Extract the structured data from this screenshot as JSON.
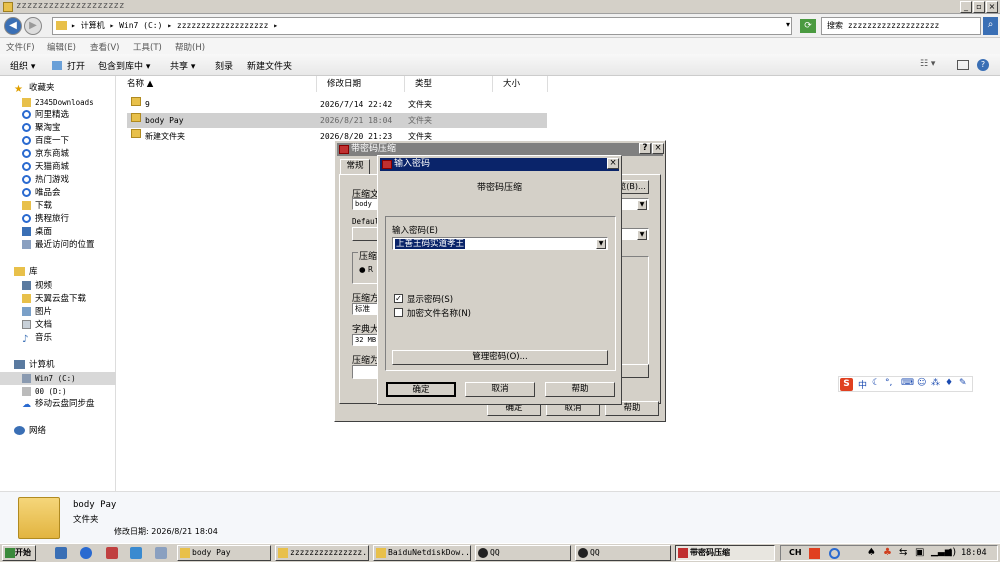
{
  "window": {
    "title": "zzzzzzzzzzzzzzzzzzzz"
  },
  "address": {
    "path": "▸ 计算机 ▸ Win7 (C:) ▸ zzzzzzzzzzzzzzzzzzz ▸",
    "search_placeholder": "搜索 zzzzzzzzzzzzzzzzzzz"
  },
  "menu": [
    "文件(F)",
    "编辑(E)",
    "查看(V)",
    "工具(T)",
    "帮助(H)"
  ],
  "toolbar": {
    "organize": "组织 ▾",
    "open": "打开",
    "include": "包含到库中 ▾",
    "share": "共享 ▾",
    "burn": "刻录",
    "new_folder": "新建文件夹"
  },
  "sidebar": {
    "favorites": "收藏夹",
    "fav_items": [
      "2345Downloads",
      "阿里精选",
      "聚淘宝",
      "百度一下",
      "京东商城",
      "天猫商城",
      "热门游戏",
      "唯品会",
      "下载",
      "携程旅行",
      "桌面",
      "最近访问的位置"
    ],
    "libraries": "库",
    "lib_items": [
      "视频",
      "天翼云盘下载",
      "图片",
      "文档",
      "音乐"
    ],
    "computer": "计算机",
    "comp_items": [
      "Win7 (C:)",
      "00 (D:)",
      "移动云盘同步盘"
    ],
    "network": "网络"
  },
  "columns": {
    "name": "名称 ▲",
    "date": "修改日期",
    "type": "类型",
    "size": "大小"
  },
  "files": [
    {
      "name": "9",
      "date": "2026/7/14 22:42",
      "type": "文件夹"
    },
    {
      "name": "body Pay",
      "date": "2026/8/21 18:04",
      "type": "文件夹"
    },
    {
      "name": "新建文件夹",
      "date": "2026/8/20 21:23",
      "type": "文件夹"
    }
  ],
  "details": {
    "name": "body Pay",
    "type": "文件夹",
    "modified": "修改日期: 2026/8/21 18:04"
  },
  "outer_dialog": {
    "title": "带密码压缩",
    "tab": "常规",
    "labels": [
      "压缩文",
      "body",
      "Defaul",
      "压缩",
      "● R",
      "压缩方",
      "标准",
      "字典大",
      "32 MB",
      "压缩为"
    ],
    "browse": "浏览(B)...",
    "ok": "确定",
    "cancel": "取消",
    "help": "帮助"
  },
  "pwd_dialog": {
    "title": "输入密码",
    "heading": "带密码压缩",
    "label": "输入密码(E)",
    "value": "上善王码实道孝王",
    "show_pwd": "显示密码(S)",
    "encrypt_names": "加密文件名称(N)",
    "manage": "管理密码(O)...",
    "ok": "确定",
    "cancel": "取消",
    "help": "帮助"
  },
  "taskbar": {
    "start": "开始",
    "tasks": [
      "body Pay",
      "zzzzzzzzzzzzzzz...",
      "BaiduNetdiskDow...",
      "QQ",
      "QQ",
      "带密码压缩"
    ],
    "lang": "CH",
    "time": "18:04"
  },
  "ime": {
    "logo": "S",
    "mode": "中"
  }
}
